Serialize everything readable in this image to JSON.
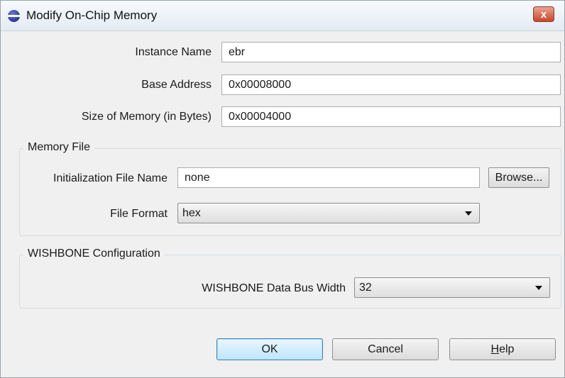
{
  "window": {
    "title": "Modify On-Chip Memory",
    "close_label": "x"
  },
  "fields": {
    "instance_name": {
      "label": "Instance Name",
      "value": "ebr"
    },
    "base_address": {
      "label": "Base Address",
      "value": "0x00008000"
    },
    "memory_size": {
      "label": "Size of Memory (in Bytes)",
      "value": "0x00004000"
    }
  },
  "memory_file": {
    "title": "Memory File",
    "init_file": {
      "label": "Initialization File Name",
      "value": "none"
    },
    "browse_label": "Browse...",
    "file_format": {
      "label": "File Format",
      "selected": "hex"
    }
  },
  "wishbone": {
    "title": "WISHBONE Configuration",
    "bus_width": {
      "label": "WISHBONE Data Bus Width",
      "selected": "32"
    }
  },
  "buttons": {
    "ok": "OK",
    "cancel": "Cancel",
    "help_mnemonic": "H",
    "help_rest": "elp"
  },
  "icons": {
    "app": "eclipse-icon",
    "close": "close-icon",
    "dropdown": "chevron-down-icon"
  }
}
